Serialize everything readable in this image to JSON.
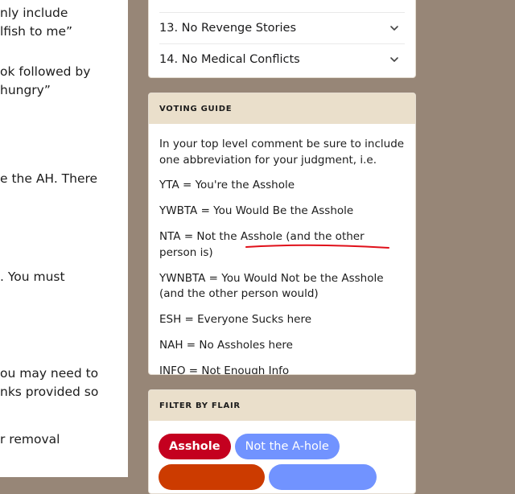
{
  "left_post": {
    "fragments": [
      "nly include",
      "lfish to me”",
      "ok followed by",
      "hungry”",
      "e the AH. There",
      ". You must",
      "ou may need to",
      "nks provided so",
      "r removal"
    ]
  },
  "rules": {
    "items": [
      {
        "label": "13. No Revenge Stories",
        "icon": "chevron-down-icon"
      },
      {
        "label": "14. No Medical Conflicts",
        "icon": "chevron-down-icon"
      }
    ]
  },
  "voting_guide": {
    "title": "VOTING GUIDE",
    "intro": "In your top level comment be sure to include one abbreviation for your judgment, i.e.",
    "lines": [
      "YTA = You're the Asshole",
      "YWBTA = You Would Be the Asshole",
      "NTA = Not the Asshole (and the other person is)",
      "YWNBTA = You Would Not be the Asshole (and the other person would)",
      "ESH = Everyone Sucks here",
      "NAH = No Assholes here",
      "INFO = Not Enough Info"
    ],
    "underline_color": "#e0101a"
  },
  "flair_filter": {
    "title": "FILTER BY FLAIR",
    "flairs": [
      {
        "label": "Asshole",
        "color": "#c4001f"
      },
      {
        "label": "Not the A-hole",
        "color": "#7193ff"
      },
      {
        "label": "",
        "color": "#cc3b00"
      },
      {
        "label": "",
        "color": "#7193ff"
      }
    ]
  },
  "colors": {
    "page_background": "#978677",
    "card_header": "#eadfcb"
  }
}
